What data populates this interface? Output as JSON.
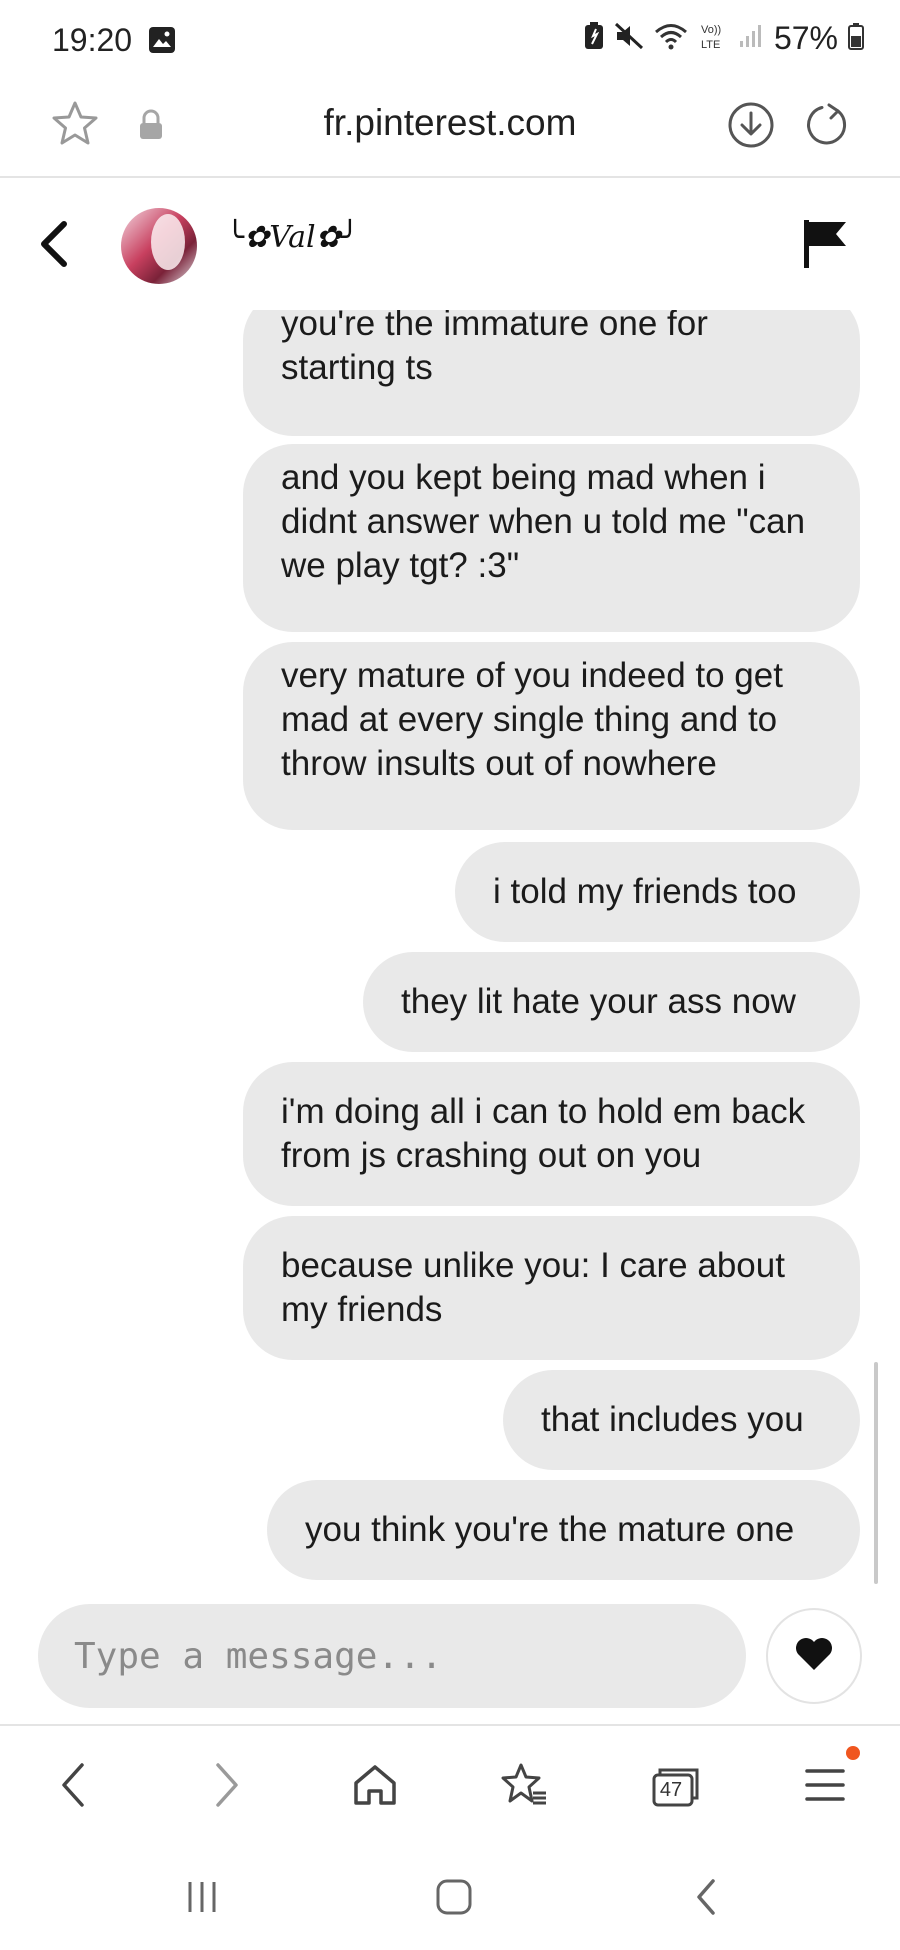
{
  "status_bar": {
    "time": "19:20",
    "battery": "57%",
    "icons": [
      "gallery-icon",
      "battery-saver-icon",
      "mute-icon",
      "wifi-icon",
      "volte-icon",
      "signal-icon",
      "battery-icon"
    ]
  },
  "url_bar": {
    "url": "fr.pinterest.com",
    "icons": [
      "star-icon",
      "lock-icon",
      "download-icon",
      "reload-icon"
    ]
  },
  "chat": {
    "username": "╰✿Val✿╯",
    "messages": [
      {
        "text": "you're the immature one for starting ts"
      },
      {
        "text": "and you kept being mad when i didnt answer when u told me \"can we play tgt? :3\""
      },
      {
        "text": "very mature of you indeed to get mad at every single thing and to throw insults out of nowhere"
      },
      {
        "text": "i told my friends too"
      },
      {
        "text": "they lit hate your ass now"
      },
      {
        "text": "i'm doing all i can to hold em back from js crashing out on you"
      },
      {
        "text": "because unlike you: I care about my friends"
      },
      {
        "text": "that includes you"
      },
      {
        "text": "you think you're the mature one"
      }
    ]
  },
  "composer": {
    "placeholder": "Type a message..."
  },
  "browser_toolbar": {
    "tabs_count": "47",
    "accent": "#f0561f"
  }
}
